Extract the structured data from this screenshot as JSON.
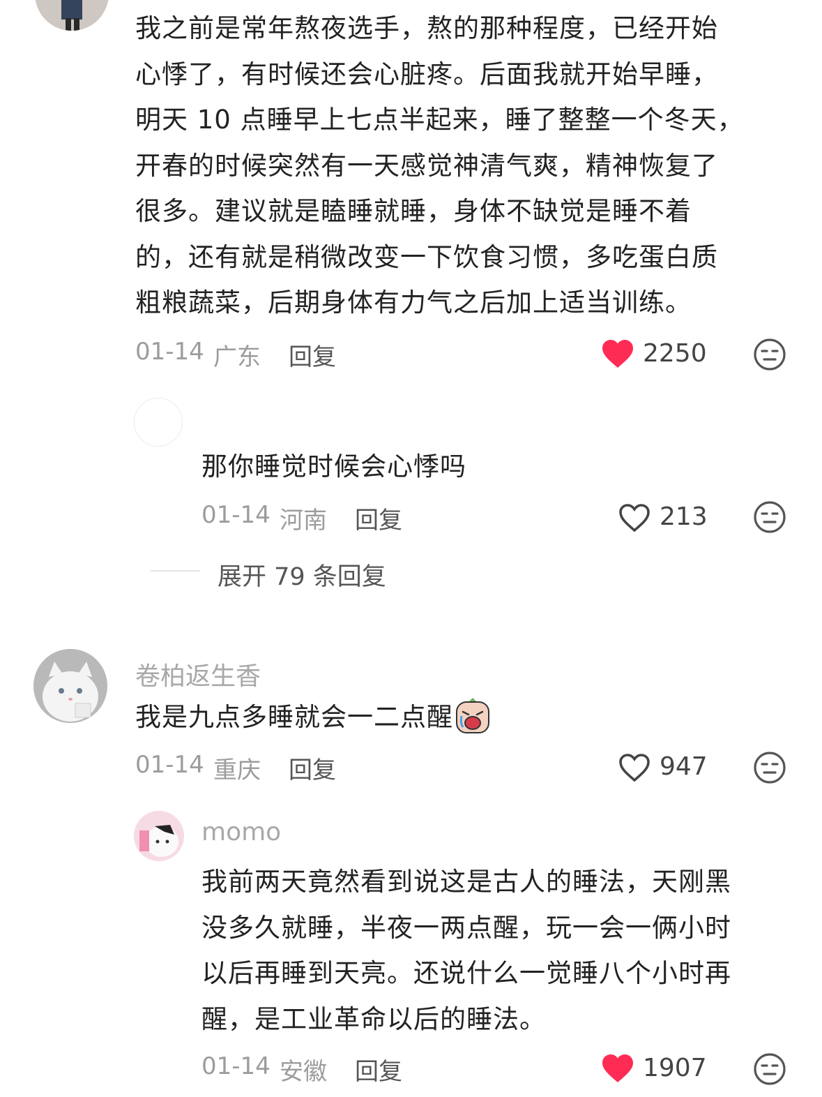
{
  "comments": [
    {
      "text_lines": [
        "我之前是常年熬夜选手，熬的那种程度，已经开始",
        "心悸了，有时候还会心脏疼。后面我就开始早睡，",
        "明天 10 点睡早上七点半起来，睡了整整一个冬天，",
        "开春的时候突然有一天感觉神清气爽，精神恢复了",
        "很多。建议就是瞌睡就睡，身体不缺觉是睡不着",
        "的，还有就是稍微改变一下饮食习惯，多吃蛋白质",
        "粗粮蔬菜，后期身体有力气之后加上适当训练。"
      ],
      "date": "01-14",
      "location": "广东",
      "reply_label": "回复",
      "likes": "2250",
      "liked": true,
      "replies": [
        {
          "text": "那你睡觉时候会心悸吗",
          "date": "01-14",
          "location": "河南",
          "reply_label": "回复",
          "likes": "213",
          "liked": false
        }
      ],
      "expand_label": "展开 79 条回复"
    },
    {
      "username": "卷柏返生香",
      "text": "我是九点多睡就会一二点醒",
      "date": "01-14",
      "location": "重庆",
      "reply_label": "回复",
      "likes": "947",
      "liked": false,
      "replies": [
        {
          "username": "momo",
          "text_lines": [
            "我前两天竟然看到说这是古人的睡法，天刚黑",
            "没多久就睡，半夜一两点醒，玩一会一俩小时",
            "以后再睡到天亮。还说什么一觉睡八个小时再",
            "醒，是工业革命以后的睡法。"
          ],
          "date": "01-14",
          "location": "安徽",
          "reply_label": "回复",
          "likes": "1907",
          "liked": true
        }
      ]
    }
  ],
  "colors": {
    "like_active": "#fe2c55",
    "meta_gray": "#9c9c9c",
    "text": "#222222"
  },
  "icons": {
    "liked": "heart-filled-icon",
    "unliked": "heart-outline-icon",
    "dislike": "meh-face-icon",
    "emoji": "crying-face-emoji"
  }
}
